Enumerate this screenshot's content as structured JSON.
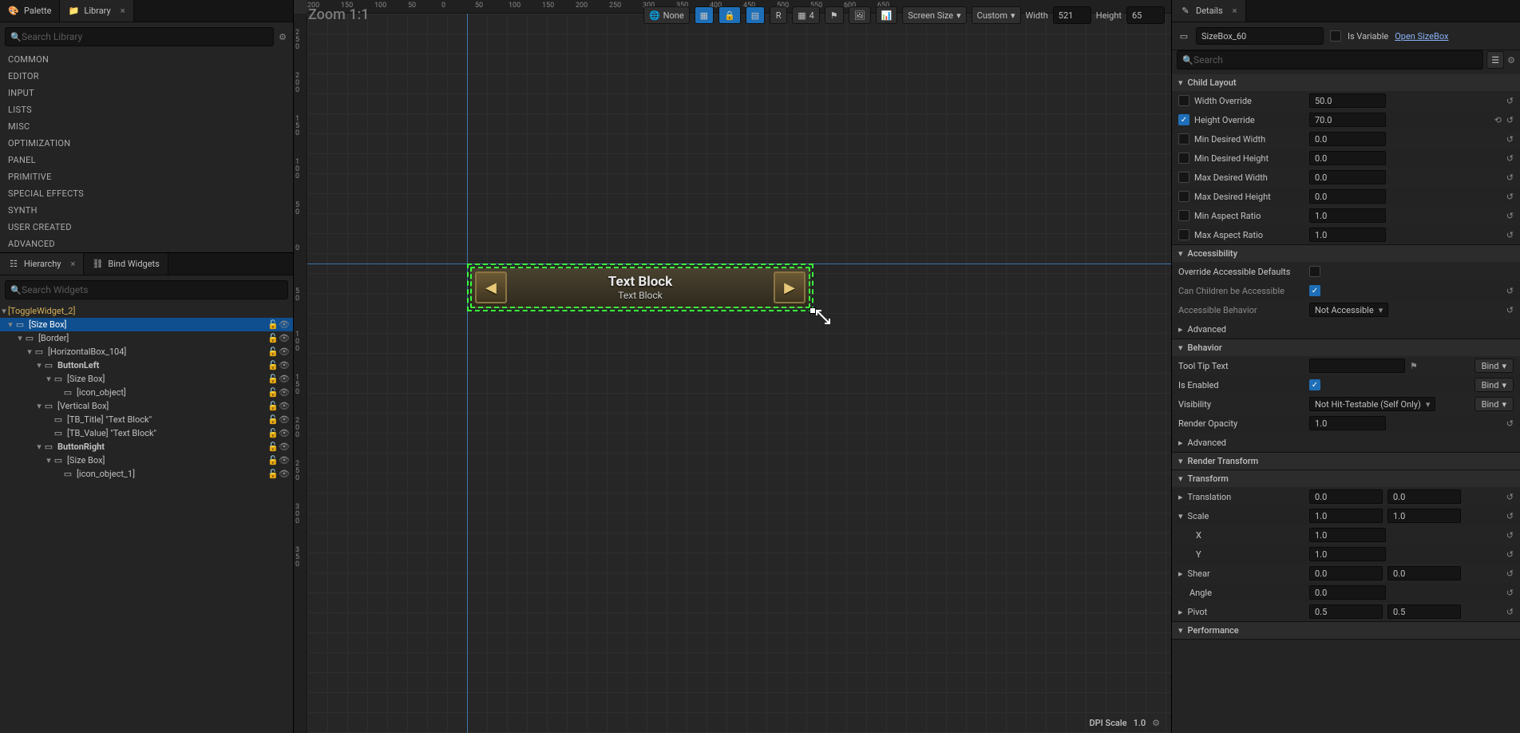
{
  "palette": {
    "tab_palette": "Palette",
    "tab_library": "Library",
    "search_placeholder": "Search Library",
    "categories": [
      "COMMON",
      "EDITOR",
      "INPUT",
      "LISTS",
      "MISC",
      "OPTIMIZATION",
      "PANEL",
      "PRIMITIVE",
      "SPECIAL EFFECTS",
      "SYNTH",
      "USER CREATED",
      "ADVANCED"
    ]
  },
  "hierarchy": {
    "tab_hierarchy": "Hierarchy",
    "tab_bind": "Bind Widgets",
    "search_placeholder": "Search Widgets",
    "root": "[ToggleWidget_2]",
    "items": [
      {
        "d": 0,
        "exp": "▾",
        "name": "[Size Box]",
        "sel": true,
        "bold": false
      },
      {
        "d": 1,
        "exp": "▾",
        "name": "[Border]"
      },
      {
        "d": 2,
        "exp": "▾",
        "name": "[HorizontalBox_104]"
      },
      {
        "d": 3,
        "exp": "▾",
        "name": "ButtonLeft",
        "bold": true
      },
      {
        "d": 4,
        "exp": "▾",
        "name": "[Size Box]"
      },
      {
        "d": 5,
        "exp": "",
        "name": "[icon_object]"
      },
      {
        "d": 3,
        "exp": "▾",
        "name": "[Vertical Box]"
      },
      {
        "d": 4,
        "exp": "",
        "name": "[TB_Title] \"Text Block\""
      },
      {
        "d": 4,
        "exp": "",
        "name": "[TB_Value] \"Text Block\""
      },
      {
        "d": 3,
        "exp": "▾",
        "name": "ButtonRight",
        "bold": true
      },
      {
        "d": 4,
        "exp": "▾",
        "name": "[Size Box]"
      },
      {
        "d": 5,
        "exp": "",
        "name": "[icon_object_1]"
      }
    ]
  },
  "viewport": {
    "zoom_label": "Zoom 1:1",
    "none": "None",
    "r": "R",
    "grid_n": "4",
    "screen_size": "Screen Size",
    "custom": "Custom",
    "width_label": "Width",
    "width": "521",
    "height_label": "Height",
    "height": "65",
    "widget_title": "Text Block",
    "widget_value": "Text Block",
    "dpi_label": "DPI Scale",
    "dpi_value": "1.0",
    "ruler_h": [
      "200",
      "150",
      "100",
      "50",
      "0",
      "50",
      "100",
      "150",
      "200",
      "250",
      "300",
      "350",
      "400",
      "450",
      "500",
      "550",
      "600",
      "650"
    ],
    "ruler_v": [
      "2 5 0",
      "2 0 0",
      "1 5 0",
      "1 0 0",
      "5 0",
      "0",
      "5 0",
      "1 0 0",
      "1 5 0",
      "2 0 0",
      "2 5 0",
      "3 0 0",
      "3 5 0"
    ]
  },
  "details": {
    "tab": "Details",
    "name": "SizeBox_60",
    "is_variable": "Is Variable",
    "open_link": "Open SizeBox",
    "search_placeholder": "Search",
    "bind_label": "Bind",
    "sections": {
      "child_layout": {
        "title": "Child Layout",
        "rows": [
          {
            "label": "Width Override",
            "checked": false,
            "value": "50.0"
          },
          {
            "label": "Height Override",
            "checked": true,
            "value": "70.0",
            "revert": true
          },
          {
            "label": "Min Desired Width",
            "checked": false,
            "value": "0.0"
          },
          {
            "label": "Min Desired Height",
            "checked": false,
            "value": "0.0"
          },
          {
            "label": "Max Desired Width",
            "checked": false,
            "value": "0.0"
          },
          {
            "label": "Max Desired Height",
            "checked": false,
            "value": "0.0"
          },
          {
            "label": "Min Aspect Ratio",
            "checked": false,
            "value": "1.0"
          },
          {
            "label": "Max Aspect Ratio",
            "checked": false,
            "value": "1.0"
          }
        ]
      },
      "accessibility": {
        "title": "Accessibility",
        "override": {
          "label": "Override Accessible Defaults",
          "checked": false
        },
        "children": {
          "label": "Can Children be Accessible",
          "checked": true
        },
        "behavior": {
          "label": "Accessible Behavior",
          "value": "Not Accessible"
        },
        "advanced": "Advanced"
      },
      "behavior": {
        "title": "Behavior",
        "tooltip": {
          "label": "Tool Tip Text",
          "value": ""
        },
        "enabled": {
          "label": "Is Enabled",
          "checked": true
        },
        "visibility": {
          "label": "Visibility",
          "value": "Not Hit-Testable (Self Only)"
        },
        "opacity": {
          "label": "Render Opacity",
          "value": "1.0"
        },
        "advanced": "Advanced"
      },
      "render_transform": {
        "title": "Render Transform"
      },
      "transform": {
        "title": "Transform",
        "translation": {
          "label": "Translation",
          "x": "0.0",
          "y": "0.0"
        },
        "scale": {
          "label": "Scale",
          "x": "1.0",
          "y": "1.0"
        },
        "xrow": {
          "label": "X",
          "value": "1.0"
        },
        "yrow": {
          "label": "Y",
          "value": "1.0"
        },
        "shear": {
          "label": "Shear",
          "x": "0.0",
          "y": "0.0"
        },
        "angle": {
          "label": "Angle",
          "value": "0.0"
        },
        "pivot": {
          "label": "Pivot",
          "x": "0.5",
          "y": "0.5"
        }
      },
      "performance": {
        "title": "Performance"
      }
    }
  }
}
